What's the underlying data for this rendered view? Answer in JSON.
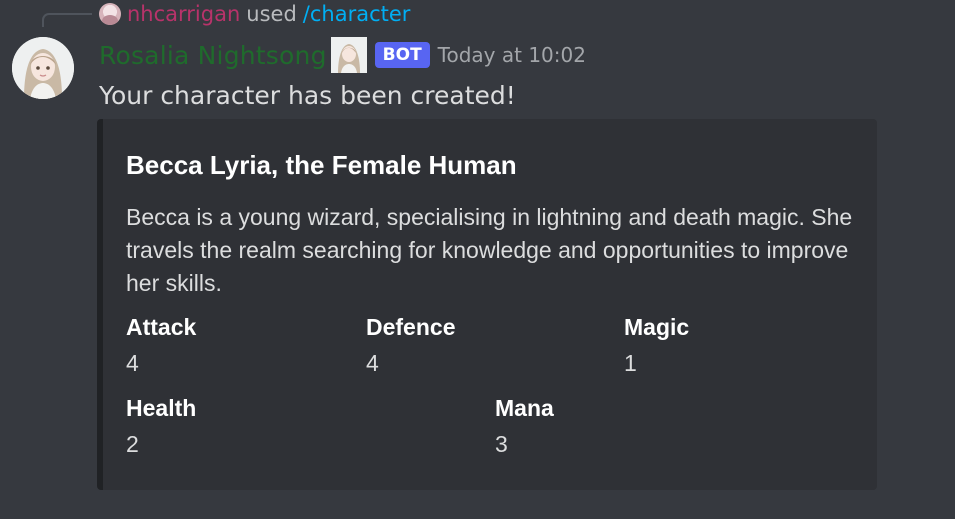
{
  "reply": {
    "username": "nhcarrigan",
    "used_text": "used",
    "command": "/character",
    "avatar_icon": "user-avatar"
  },
  "message": {
    "author": "Rosalia Nightsong",
    "author_color": "#1f6b2c",
    "bot_tag": "BOT",
    "timestamp": "Today at 10:02",
    "content": "Your character has been created!",
    "avatar_icon": "anime-girl-avatar"
  },
  "embed": {
    "title": "Becca Lyria, the Female Human",
    "description": "Becca is a young wizard, specialising in lightning and death magic. She travels the realm searching for knowledge and opportunities to improve her skills.",
    "fields": [
      {
        "name": "Attack",
        "value": "4"
      },
      {
        "name": "Defence",
        "value": "4"
      },
      {
        "name": "Magic",
        "value": "1"
      },
      {
        "name": "Health",
        "value": "2"
      },
      {
        "name": "Mana",
        "value": "3"
      }
    ]
  },
  "colors": {
    "background": "#36393f",
    "embed_background": "#2f3136",
    "bot_tag": "#5865f2",
    "command": "#00aff4",
    "reply_user": "#b8336a"
  }
}
